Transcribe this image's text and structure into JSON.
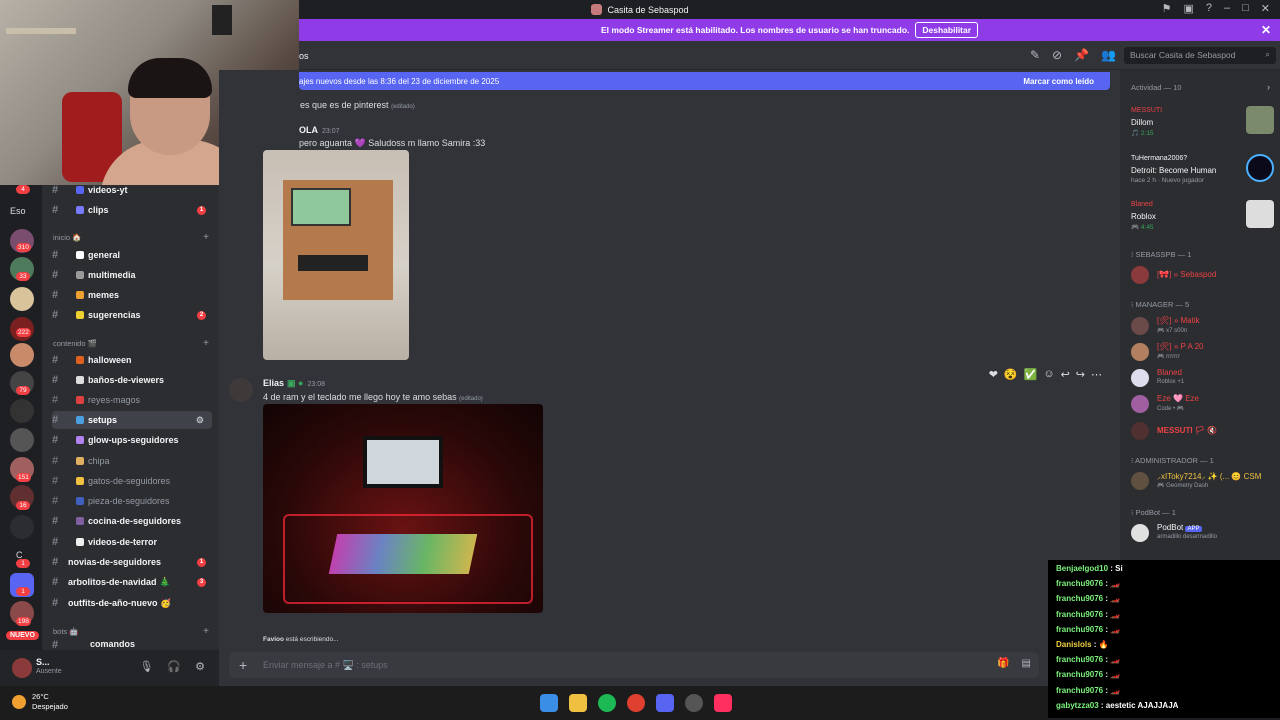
{
  "titlebar": {
    "title": "Casita de Sebaspod"
  },
  "streamer": {
    "message": "El modo Streamer está habilitado. Los nombres de usuario se han truncado.",
    "button": "Deshabilitar"
  },
  "topbar": {
    "channel": "os"
  },
  "search": {
    "placeholder": "Buscar Casita de Sebaspod"
  },
  "guilds": {
    "badges": [
      "4",
      "310",
      "33",
      "222",
      "79",
      "151",
      "16",
      "1",
      "1",
      "198"
    ],
    "labels": [
      "Eso",
      "C"
    ],
    "nuevo": "NUEVO"
  },
  "channels": {
    "items": [
      {
        "name": "videos-yt",
        "bold": true
      },
      {
        "name": "clips",
        "bold": true,
        "unread": "1"
      }
    ],
    "cat_inicio": "inicio 🏠",
    "inicio": [
      {
        "name": "general",
        "bold": true
      },
      {
        "name": "multimedia",
        "bold": true
      },
      {
        "name": "memes",
        "bold": true
      },
      {
        "name": "sugerencias",
        "bold": true,
        "unread": "2"
      }
    ],
    "cat_contenido": "contenido 🎬",
    "contenido": [
      {
        "name": "halloween",
        "bold": true
      },
      {
        "name": "baños-de-viewers",
        "bold": true
      },
      {
        "name": "reyes-magos",
        "bold": false
      },
      {
        "name": "setups",
        "bold": true,
        "selected": true
      },
      {
        "name": "glow-ups-seguidores",
        "bold": true
      },
      {
        "name": "chipa",
        "bold": false
      },
      {
        "name": "gatos-de-seguidores",
        "bold": false
      },
      {
        "name": "pieza-de-seguidores",
        "bold": false
      },
      {
        "name": "cocina-de-seguidores",
        "bold": true
      },
      {
        "name": "videos-de-terror",
        "bold": true
      }
    ],
    "extra": [
      {
        "name": "novias-de-seguidores",
        "unread": "1"
      },
      {
        "name": "arbolitos-de-navidad 🎄",
        "unread": "3"
      },
      {
        "name": "outfits-de-año-nuevo 🥳"
      }
    ],
    "cat_bots": "bots 🤖",
    "partial": "comandos"
  },
  "user": {
    "name": "S...",
    "status": "Ausente"
  },
  "newbar": {
    "text": "ajes nuevos desde las 8:36 del 23 de diciembre de 2025",
    "mark": "Marcar como leído"
  },
  "messages": {
    "m0": "es que es de pinterest",
    "edited": "(editado)",
    "a1": "OLA",
    "t1": "23:07",
    "m1": "pero aguanta 💜 Saludoss m llamo Samira :33",
    "a2": "Elias",
    "t2": "23:08",
    "m2": "4 de ram y el teclado me llego hoy te amo sebas",
    "typing_user": "Favioo",
    "typing": "está escribiendo..."
  },
  "compose": {
    "placeholder": "Enviar mensaje a #  🖥️ : setups"
  },
  "members": {
    "activity": "Actividad — 10",
    "cards": [
      {
        "name": "MESSUTI",
        "game": "Dillom",
        "time": "🎵 2:15",
        "color": "#ed4245"
      },
      {
        "name": "TuHermana2006?",
        "game": "Detroit: Become Human",
        "time": "hace 2 h · Nuevo jugador",
        "color": "#f2f3f5"
      },
      {
        "name": "Blaned",
        "game": "Roblox",
        "time": "🎮 4:45",
        "color": "#ed4245"
      }
    ],
    "roles": [
      {
        "title": "⁝ SEBASSPB — 1",
        "members": [
          {
            "name": "[🎀] » Sebaspod",
            "sub": "",
            "color": "#ed4245"
          }
        ]
      },
      {
        "title": "⁝ MANAGER — 5",
        "members": [
          {
            "name": "[🛠] » Matik",
            "sub": "🎮 x7 s00n",
            "color": "#ed4245"
          },
          {
            "name": "[🛠] » P A 20",
            "sub": "🎮 rrrrrrr",
            "color": "#ed4245"
          },
          {
            "name": "Blaned",
            "sub": "Roblox +1",
            "color": "#ed4245"
          },
          {
            "name": "Eze 🩷 Eze",
            "sub": "Code • 🎮",
            "color": "#ed4245"
          },
          {
            "name": "MESSUTI 🏳 🔇",
            "sub": "",
            "color": "#ed4245"
          }
        ]
      },
      {
        "title": "⁝ ADMINISTRADOR — 1",
        "members": [
          {
            "name": "⸝xIToky7214⸝ ✨ (... 😊 CSM",
            "sub": "🎮 Geometry Dash",
            "color": "#f0c040"
          }
        ]
      },
      {
        "title": "⁝ PodBot — 1",
        "members": [
          {
            "name": "PodBot",
            "sub": "armadillo desarmadillo",
            "color": "#f2f3f5",
            "app": "APP"
          }
        ]
      }
    ]
  },
  "chat": [
    {
      "u": "Benjaelgod10",
      "m": "Si"
    },
    {
      "u": "franchu9076",
      "m": "🏎️"
    },
    {
      "u": "franchu9076",
      "m": "🏎️"
    },
    {
      "u": "franchu9076",
      "m": "🏎️"
    },
    {
      "u": "franchu9076",
      "m": "🏎️"
    },
    {
      "u": "Danislols",
      "m": "🔥"
    },
    {
      "u": "franchu9076",
      "m": "🏎️"
    },
    {
      "u": "franchu9076",
      "m": "🏎️"
    },
    {
      "u": "franchu9076",
      "m": "🏎️"
    },
    {
      "u": "gabytzza03",
      "m": "aestetic AJAJJAJA"
    }
  ],
  "weather": {
    "temp": "26°C",
    "desc": "Despejado"
  },
  "colors": {
    "streamer": "#8f3ce8",
    "blurple": "#5865f2",
    "unread": "#f23f43"
  }
}
